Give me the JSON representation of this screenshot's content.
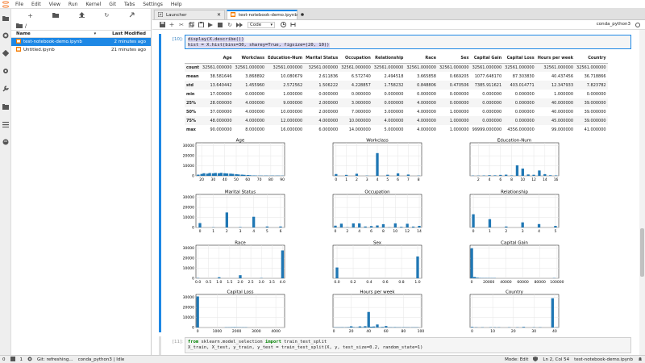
{
  "menubar": {
    "items": [
      "File",
      "Edit",
      "View",
      "Run",
      "Kernel",
      "Git",
      "Tabs",
      "Settings",
      "Help"
    ]
  },
  "activity_icons": [
    "folder-icon",
    "running-icon",
    "git-icon",
    "extension-icon",
    "wrench-icon",
    "tabs-icon",
    "list-icon",
    "palette-icon"
  ],
  "filebrowser": {
    "breadcrumb": "/",
    "col_name": "Name",
    "col_modified": "Last Modified",
    "files": [
      {
        "name": "test-notebook-demo.ipynb",
        "modified": "2 minutes ago",
        "selected": true
      },
      {
        "name": "Untitled.ipynb",
        "modified": "21 minutes ago",
        "selected": false
      }
    ]
  },
  "tabs": [
    {
      "label": "Launcher",
      "active": false
    },
    {
      "label": "test-notebook-demo.ipynb",
      "active": true
    }
  ],
  "toolbar": {
    "cell_type": "Code",
    "kernel_name": "conda_python3"
  },
  "cells": {
    "cell10": {
      "prompt": "[10]:",
      "line1": "display(X.describe())",
      "line2": "hist = X.hist(bins=30, sharey=True, figsize=(20, 10))"
    },
    "cell11": {
      "prompt": "[11]:",
      "line1_a": "from",
      "line1_b": " sklearn.model_selection ",
      "line1_c": "import",
      "line1_d": " train_test_split",
      "line2": "X_train, X_test, y_train, y_test = train_test_split(X, y, test_size=0.2, random_state=1)"
    }
  },
  "describe_table": {
    "columns": [
      "",
      "Age",
      "Workclass",
      "Education-Num",
      "Marital Status",
      "Occupation",
      "Relationship",
      "Race",
      "Sex",
      "Capital Gain",
      "Capital Loss",
      "Hours per week",
      "Country"
    ],
    "rows": [
      [
        "count",
        "32561.000000",
        "32561.000000",
        "32561.000000",
        "32561.000000",
        "32561.000000",
        "32561.000000",
        "32561.000000",
        "32561.000000",
        "32561.000000",
        "32561.000000",
        "32561.000000",
        "32561.000000"
      ],
      [
        "mean",
        "38.581646",
        "3.868892",
        "10.080679",
        "2.611836",
        "6.572740",
        "2.494518",
        "3.665858",
        "0.669205",
        "1077.648170",
        "87.303830",
        "40.437456",
        "36.718866"
      ],
      [
        "std",
        "13.640442",
        "1.455960",
        "2.572562",
        "1.506222",
        "4.228857",
        "1.758232",
        "0.848806",
        "0.470506",
        "7385.911621",
        "403.014771",
        "12.347933",
        "7.823782"
      ],
      [
        "min",
        "17.000000",
        "0.000000",
        "1.000000",
        "0.000000",
        "0.000000",
        "0.000000",
        "0.000000",
        "0.000000",
        "0.000000",
        "0.000000",
        "1.000000",
        "0.000000"
      ],
      [
        "25%",
        "28.000000",
        "4.000000",
        "9.000000",
        "2.000000",
        "3.000000",
        "0.000000",
        "4.000000",
        "0.000000",
        "0.000000",
        "0.000000",
        "40.000000",
        "39.000000"
      ],
      [
        "50%",
        "37.000000",
        "4.000000",
        "10.000000",
        "2.000000",
        "7.000000",
        "3.000000",
        "4.000000",
        "1.000000",
        "0.000000",
        "0.000000",
        "40.000000",
        "39.000000"
      ],
      [
        "75%",
        "48.000000",
        "4.000000",
        "12.000000",
        "4.000000",
        "10.000000",
        "4.000000",
        "4.000000",
        "1.000000",
        "0.000000",
        "0.000000",
        "45.000000",
        "39.000000"
      ],
      [
        "max",
        "90.000000",
        "8.000000",
        "16.000000",
        "6.000000",
        "14.000000",
        "5.000000",
        "4.000000",
        "1.000000",
        "99999.000000",
        "4356.000000",
        "99.000000",
        "41.000000"
      ]
    ]
  },
  "chart_data": [
    {
      "type": "bar",
      "title": "Age",
      "xlim": [
        15,
        92
      ],
      "ylim": [
        0,
        33000
      ],
      "yticks": [
        0,
        10000,
        20000,
        30000
      ],
      "xticks": [
        20,
        30,
        40,
        50,
        60,
        70,
        80,
        90
      ],
      "x": [
        17,
        20,
        22,
        25,
        27,
        30,
        32,
        35,
        37,
        40,
        42,
        45,
        47,
        50,
        52,
        55,
        57,
        60,
        62,
        65,
        67,
        70,
        72,
        75,
        77,
        80,
        82,
        85,
        87,
        90
      ],
      "values": [
        1200,
        1900,
        2600,
        2200,
        2800,
        2500,
        2900,
        2600,
        3000,
        2600,
        2400,
        2200,
        2000,
        1700,
        1400,
        1200,
        1000,
        800,
        600,
        400,
        300,
        200,
        150,
        100,
        70,
        40,
        30,
        20,
        10,
        40
      ]
    },
    {
      "type": "bar",
      "title": "Workclass",
      "xlim": [
        -0.3,
        8.3
      ],
      "ylim": [
        0,
        33000
      ],
      "xticks": [
        0,
        1,
        2,
        3,
        4,
        5,
        6,
        7,
        8
      ],
      "x": [
        0,
        1,
        2,
        3,
        4,
        5,
        6,
        7,
        8
      ],
      "values": [
        1800,
        960,
        2100,
        10,
        22700,
        1100,
        2500,
        1300,
        14
      ]
    },
    {
      "type": "bar",
      "title": "Education-Num",
      "xlim": [
        0.5,
        16.5
      ],
      "ylim": [
        0,
        33000
      ],
      "xticks": [
        2,
        4,
        6,
        8,
        10,
        12,
        14,
        16
      ],
      "x": [
        1,
        2,
        3,
        4,
        5,
        6,
        7,
        8,
        9,
        10,
        11,
        12,
        13,
        14,
        15,
        16
      ],
      "values": [
        50,
        170,
        330,
        650,
        510,
        930,
        1170,
        430,
        10500,
        7300,
        1380,
        1070,
        5350,
        1720,
        580,
        410
      ]
    },
    {
      "type": "bar",
      "title": "Marital Status",
      "xlim": [
        -0.3,
        6.3
      ],
      "ylim": [
        0,
        33000
      ],
      "xticks": [
        0,
        1,
        2,
        3,
        4,
        5,
        6
      ],
      "x": [
        0,
        1,
        2,
        3,
        4,
        5,
        6
      ],
      "values": [
        4400,
        23,
        15000,
        420,
        10700,
        1000,
        990
      ]
    },
    {
      "type": "bar",
      "title": "Occupation",
      "xlim": [
        -0.4,
        14.4
      ],
      "ylim": [
        0,
        33000
      ],
      "xticks": [
        0,
        2,
        4,
        6,
        8,
        10,
        12,
        14
      ],
      "x": [
        0,
        1,
        2,
        3,
        4,
        5,
        6,
        7,
        8,
        9,
        10,
        11,
        12,
        13,
        14
      ],
      "values": [
        1800,
        3800,
        9,
        4100,
        4100,
        990,
        1400,
        2000,
        3300,
        150,
        4100,
        650,
        3700,
        930,
        1600
      ]
    },
    {
      "type": "bar",
      "title": "Relationship",
      "xlim": [
        -0.2,
        5.2
      ],
      "ylim": [
        0,
        33000
      ],
      "xticks": [
        0,
        1,
        2,
        3,
        4,
        5
      ],
      "x": [
        0,
        1,
        2,
        3,
        4,
        5
      ],
      "values": [
        13200,
        8300,
        980,
        5100,
        3400,
        1570
      ]
    },
    {
      "type": "bar",
      "title": "Race",
      "xlim": [
        -0.1,
        4.1
      ],
      "ylim": [
        0,
        33000
      ],
      "xticks": [
        0.0,
        0.5,
        1.0,
        1.5,
        2.0,
        2.5,
        3.0,
        3.5,
        4.0
      ],
      "x": [
        0,
        1,
        2,
        3,
        4
      ],
      "values": [
        310,
        1040,
        3100,
        270,
        27800
      ]
    },
    {
      "type": "bar",
      "title": "Sex",
      "xlim": [
        -0.05,
        1.05
      ],
      "ylim": [
        0,
        33000
      ],
      "xticks": [
        0.0,
        0.2,
        0.4,
        0.6,
        0.8,
        1.0
      ],
      "x": [
        0,
        1
      ],
      "values": [
        10800,
        21800
      ]
    },
    {
      "type": "bar",
      "title": "Capital Gain",
      "xlim": [
        -2000,
        102000
      ],
      "ylim": [
        0,
        33000
      ],
      "xticks": [
        0,
        20000,
        40000,
        60000,
        80000,
        100000
      ],
      "x": [
        0,
        3333,
        6666,
        10000,
        13333,
        16666,
        20000,
        23333,
        26666,
        96666
      ],
      "values": [
        30000,
        1300,
        600,
        300,
        200,
        80,
        50,
        30,
        20,
        160
      ]
    },
    {
      "type": "bar",
      "title": "Capital Loss",
      "xlim": [
        -90,
        4450
      ],
      "ylim": [
        0,
        33000
      ],
      "xticks": [
        0,
        1000,
        2000,
        3000,
        4000
      ],
      "x": [
        0,
        1452,
        1597,
        1742,
        1887,
        2032,
        2178,
        2323,
        2468
      ],
      "values": [
        31000,
        40,
        120,
        300,
        400,
        250,
        80,
        40,
        20
      ]
    },
    {
      "type": "bar",
      "title": "Hours per week",
      "xlim": [
        -1,
        101
      ],
      "ylim": [
        0,
        33000
      ],
      "xticks": [
        0,
        20,
        40,
        60,
        80,
        100
      ],
      "x": [
        1,
        4,
        7,
        10,
        14,
        17,
        20,
        23,
        27,
        30,
        33,
        36,
        40,
        43,
        46,
        50,
        53,
        56,
        60,
        63,
        66,
        70,
        73,
        76,
        80,
        83,
        86,
        90,
        93,
        96
      ],
      "values": [
        40,
        60,
        80,
        300,
        200,
        400,
        1200,
        400,
        300,
        1100,
        400,
        1300,
        15500,
        800,
        1000,
        3000,
        300,
        600,
        1500,
        200,
        300,
        400,
        100,
        100,
        300,
        50,
        50,
        50,
        20,
        80
      ]
    },
    {
      "type": "bar",
      "title": "Country",
      "xlim": [
        -1,
        42
      ],
      "ylim": [
        0,
        33000
      ],
      "xticks": [
        0,
        10,
        20,
        30,
        40
      ],
      "x": [
        0,
        2,
        5,
        9,
        11,
        13,
        18,
        22,
        25,
        30,
        33,
        39,
        41
      ],
      "values": [
        580,
        120,
        100,
        90,
        110,
        70,
        60,
        75,
        640,
        100,
        200,
        29200,
        20
      ]
    }
  ],
  "statusbar": {
    "zero": "0",
    "one": "1",
    "git": "Git: refreshing...",
    "kernel": "conda_python3 | Idle",
    "mode": "Mode: Edit",
    "position": "Ln 2, Col 54",
    "filename": "test-notebook-demo.ipynb"
  }
}
